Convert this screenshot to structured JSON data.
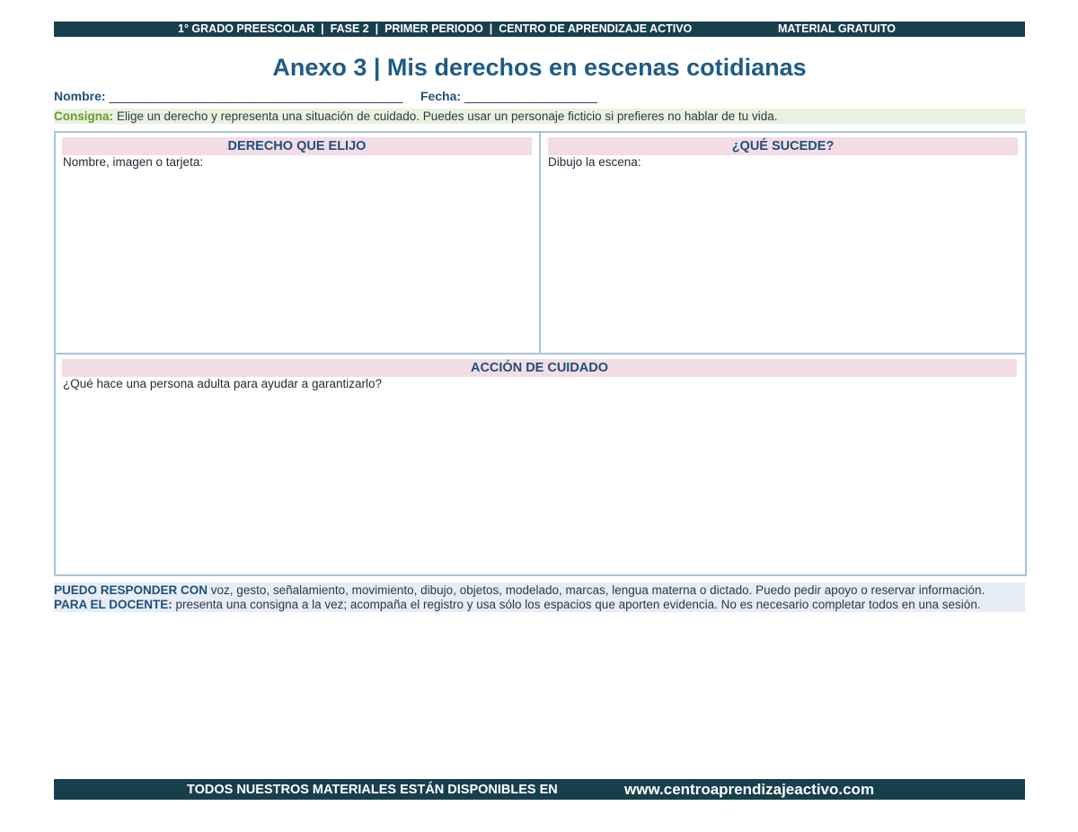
{
  "header": {
    "left": "1° GRADO PREESCOLAR  |  FASE 2  |  PRIMER PERIODO  |  CENTRO DE APRENDIZAJE ACTIVO",
    "right": "MATERIAL GRATUITO"
  },
  "title": "Anexo 3 | Mis derechos en escenas cotidianas",
  "form": {
    "name_label": "Nombre:",
    "name_line": "__________________________________________",
    "date_label": "Fecha:",
    "date_line": "___________________"
  },
  "consigna": {
    "label": "Consigna:",
    "text": "Elige un derecho y representa una situación de cuidado. Puedes usar un personaje ficticio si prefieres no hablar de tu vida."
  },
  "sections": {
    "derecho": {
      "title": "DERECHO QUE ELIJO",
      "prompt": "Nombre, imagen o tarjeta:"
    },
    "sucede": {
      "title": "¿QUÉ SUCEDE?",
      "prompt": "Dibujo la escena:"
    },
    "accion": {
      "title": "ACCIÓN DE CUIDADO",
      "prompt": "¿Qué hace una persona adulta para ayudar a garantizarlo?"
    }
  },
  "notes": {
    "respond_label": "PUEDO RESPONDER CON",
    "respond_text": "voz, gesto, señalamiento, movimiento, dibujo, objetos, modelado, marcas, lengua materna o dictado. Puedo pedir apoyo o reservar información.",
    "teacher_label": "PARA EL DOCENTE:",
    "teacher_text": "presenta una consigna a la vez; acompaña el registro y usa sólo los espacios que aporten evidencia. No es necesario completar todos en una sesión."
  },
  "footer": {
    "text": "TODOS NUESTROS MATERIALES ESTÁN DISPONIBLES EN",
    "url": "www.centroaprendizajeactivo.com"
  }
}
